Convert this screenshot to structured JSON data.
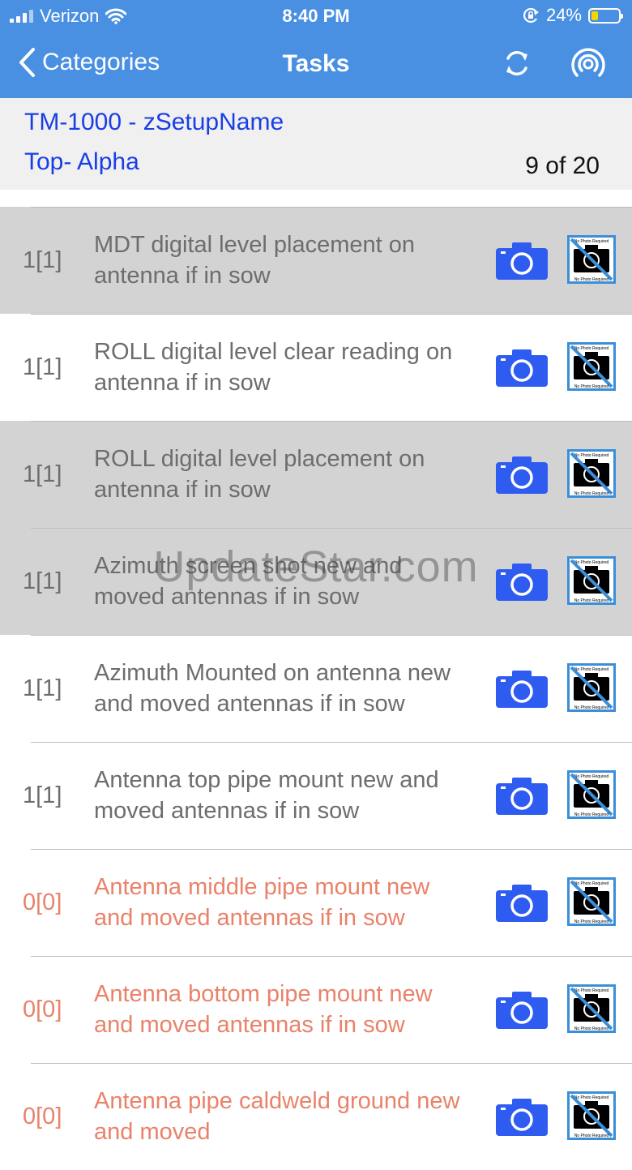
{
  "status_bar": {
    "carrier": "Verizon",
    "time": "8:40 PM",
    "battery": "24%",
    "battery_level": 0.24,
    "icons": [
      "signal-bars-icon",
      "wifi-icon",
      "orientation-lock-icon",
      "battery-icon"
    ]
  },
  "nav": {
    "back_label": "Categories",
    "title": "Tasks",
    "icons": [
      "chevron-left-icon",
      "sync-icon",
      "broadcast-icon"
    ]
  },
  "header": {
    "site": "TM-1000 - zSetupName",
    "section": "Top- Alpha",
    "position": "9 of 20"
  },
  "tasks": [
    {
      "count": "1[1]",
      "text": "MDT digital level placement on antenna if in sow",
      "status": "done",
      "shaded": true
    },
    {
      "count": "1[1]",
      "text": "ROLL digital level clear reading on antenna if in sow",
      "status": "done",
      "shaded": false
    },
    {
      "count": "1[1]",
      "text": "ROLL digital level placement on antenna if in sow",
      "status": "done",
      "shaded": true
    },
    {
      "count": "1[1]",
      "text": "Azimuth screen shot new and moved antennas if in sow",
      "status": "done",
      "shaded": true
    },
    {
      "count": "1[1]",
      "text": "Azimuth Mounted on antenna new and moved antennas if in sow",
      "status": "done",
      "shaded": false
    },
    {
      "count": "1[1]",
      "text": "Antenna top pipe mount new and moved antennas if in sow",
      "status": "done",
      "shaded": false
    },
    {
      "count": "0[0]",
      "text": "Antenna middle pipe mount new and moved antennas if in sow",
      "status": "pending",
      "shaded": false
    },
    {
      "count": "0[0]",
      "text": "Antenna bottom pipe mount new and moved antennas if in sow",
      "status": "pending",
      "shaded": false
    },
    {
      "count": "0[0]",
      "text": "Antenna pipe caldweld ground new and moved",
      "status": "pending",
      "shaded": false
    }
  ],
  "no_photo_badge": {
    "top": "No Photo Required",
    "bottom": "No Photo Required"
  },
  "watermark": "UpdateStar.com",
  "colors": {
    "nav_blue": "#4a90e2",
    "header_link": "#1a3ee6",
    "camera_blue": "#2f5cf0",
    "pending_text": "#e9826a",
    "done_text": "#6d6d6d",
    "shaded_row": "#d3d3d3"
  }
}
